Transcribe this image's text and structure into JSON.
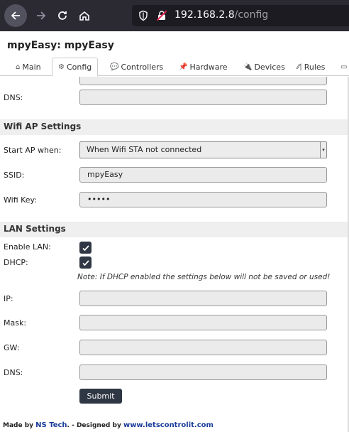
{
  "browser": {
    "url_host": "192.168.2.8",
    "url_path": "/config"
  },
  "page": {
    "title": "mpyEasy: mpyEasy"
  },
  "tabs": [
    {
      "label": "Main",
      "icon": "home-icon"
    },
    {
      "label": "Config",
      "icon": "gear-icon"
    },
    {
      "label": "Controllers",
      "icon": "speech-bubble-icon"
    },
    {
      "label": "Hardware",
      "icon": "pushpin-icon"
    },
    {
      "label": "Devices",
      "icon": "plug-icon"
    },
    {
      "label": "Rules",
      "icon": "rules-icon"
    }
  ],
  "network": {
    "dns_label": "DNS:",
    "dns_value": ""
  },
  "wifi_ap": {
    "title": "Wifi AP Settings",
    "start_ap_label": "Start AP when:",
    "start_ap_value": "When Wifi STA not connected",
    "ssid_label": "SSID:",
    "ssid_value": "mpyEasy",
    "wifi_key_label": "Wifi Key:",
    "wifi_key_value": "•••••"
  },
  "lan": {
    "title": "LAN Settings",
    "enable_label": "Enable LAN:",
    "enable_checked": true,
    "dhcp_label": "DHCP:",
    "dhcp_checked": true,
    "note": "Note: If DHCP enabled the settings below will not be saved or used!",
    "ip_label": "IP:",
    "ip_value": "",
    "mask_label": "Mask:",
    "mask_value": "",
    "gw_label": "GW:",
    "gw_value": "",
    "dns_label": "DNS:",
    "dns_value": ""
  },
  "actions": {
    "submit_label": "Submit"
  },
  "footer": {
    "made_by": "Made by ",
    "author": "NS Tech",
    "designed_by": ". - Designed by ",
    "site": "www.letscontrolit.com"
  }
}
